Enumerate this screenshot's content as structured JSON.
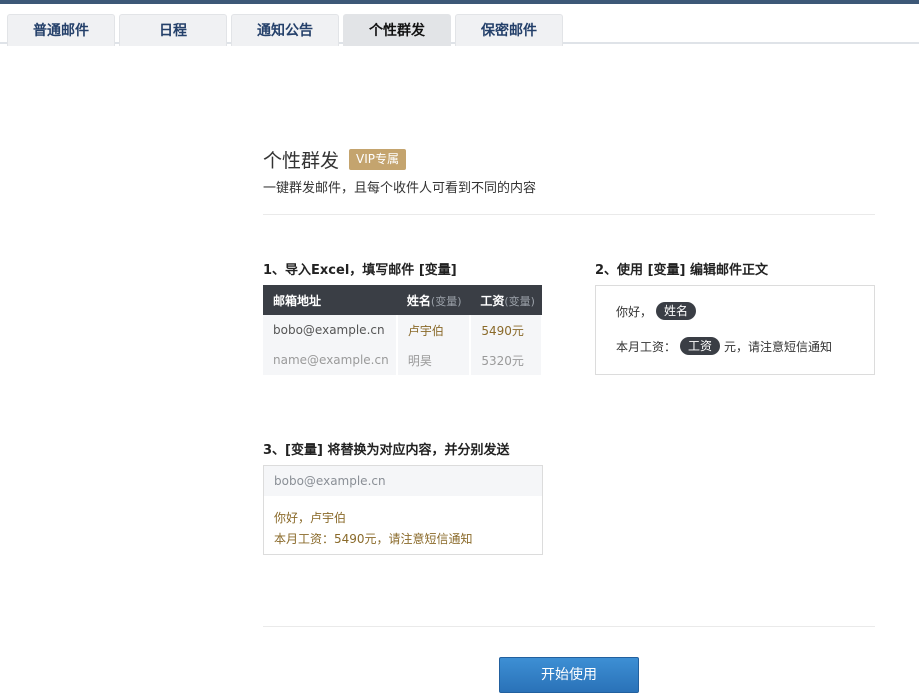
{
  "tabs": [
    {
      "label": "普通邮件"
    },
    {
      "label": "日程"
    },
    {
      "label": "通知公告"
    },
    {
      "label": "个性群发"
    },
    {
      "label": "保密邮件"
    }
  ],
  "header": {
    "title": "个性群发",
    "badge": "VIP专属",
    "subtitle": "一键群发邮件，且每个收件人可看到不同的内容"
  },
  "step1": {
    "title": "1、导入Excel，填写邮件 [变量]",
    "columns": [
      {
        "label": "邮箱地址",
        "var": ""
      },
      {
        "label": "姓名",
        "var": "(变量)"
      },
      {
        "label": "工资",
        "var": "(变量)"
      }
    ],
    "rows": [
      [
        "bobo@example.cn",
        "卢宇伯",
        "5490元"
      ],
      [
        "name@example.cn",
        "明昊",
        "5320元"
      ]
    ]
  },
  "step2": {
    "title": "2、使用 [变量] 编辑邮件正文",
    "line1_prefix": "你好，",
    "line1_var": "姓名",
    "line2_prefix": "本月工资：",
    "line2_var": "工资",
    "line2_suffix": "元，请注意短信通知"
  },
  "step3": {
    "title": "3、[变量] 将替换为对应内容，并分别发送",
    "recipient": "bobo@example.cn",
    "line1": "你好，卢宇伯",
    "line2": "本月工资：5490元，请注意短信通知"
  },
  "button": {
    "label": "开始使用"
  },
  "colors": {
    "accent": "#2a72b8",
    "badge": "#c4a46e",
    "table_header": "#3a3e45",
    "var_text": "#8a6a2a"
  }
}
